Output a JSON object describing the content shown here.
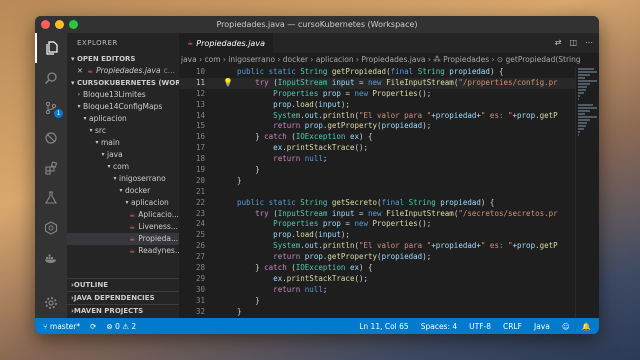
{
  "window": {
    "title": "Propiedades.java — cursoKubernetes (Workspace)"
  },
  "activity_bar": {
    "scm_badge": "1"
  },
  "sidebar": {
    "title": "EXPLORER",
    "open_editors_label": "OPEN EDITORS",
    "open_editor_file": "Propiedades.java",
    "open_editor_folder": "c...",
    "workspace_label": "CURSOKUBERNETES (WOR...",
    "tree": [
      {
        "label": "Bloque13Limites",
        "indent": 0,
        "type": "folder-collapsed"
      },
      {
        "label": "Bloque14ConfigMaps",
        "indent": 0,
        "type": "folder-open"
      },
      {
        "label": "aplicacion",
        "indent": 1,
        "type": "folder-open"
      },
      {
        "label": "src",
        "indent": 2,
        "type": "folder-open"
      },
      {
        "label": "main",
        "indent": 3,
        "type": "folder-open"
      },
      {
        "label": "java",
        "indent": 4,
        "type": "folder-open"
      },
      {
        "label": "com",
        "indent": 5,
        "type": "folder-open"
      },
      {
        "label": "inigoserrano",
        "indent": 6,
        "type": "folder-open"
      },
      {
        "label": "docker",
        "indent": 7,
        "type": "folder-open"
      },
      {
        "label": "aplicacion",
        "indent": 8,
        "type": "folder-open"
      },
      {
        "label": "Aplicacio...",
        "indent": 9,
        "type": "java"
      },
      {
        "label": "Liveness...",
        "indent": 9,
        "type": "java"
      },
      {
        "label": "Propieda...",
        "indent": 9,
        "type": "java",
        "selected": true
      },
      {
        "label": "Readynes...",
        "indent": 9,
        "type": "java"
      }
    ],
    "outline_label": "OUTLINE",
    "java_deps_label": "JAVA DEPENDENCIES",
    "maven_label": "MAVEN PROJECTS"
  },
  "editor": {
    "tab_label": "Propiedades.java",
    "breadcrumb": "java › com › inigoserrano › docker › aplicacion › Propiedades.java › ⁂ Propiedades › ⊙ getPropiedad(String",
    "lines": [
      {
        "n": "10",
        "tokens": [
          [
            "kw",
            "    public static "
          ],
          [
            "ty",
            "String "
          ],
          [
            "fn",
            "getPropiedad"
          ],
          [
            "pl",
            "("
          ],
          [
            "kw",
            "final "
          ],
          [
            "ty",
            "String "
          ],
          [
            "var",
            "propiedad"
          ],
          [
            "pl",
            ") {"
          ]
        ]
      },
      {
        "n": "11",
        "cur": true,
        "tokens": [
          [
            "ctl",
            "        try "
          ],
          [
            "pl",
            "("
          ],
          [
            "ty",
            "InputStream "
          ],
          [
            "var",
            "input"
          ],
          [
            "pl",
            " = "
          ],
          [
            "kw",
            "new "
          ],
          [
            "fn",
            "FileInputStream"
          ],
          [
            "pl",
            "("
          ],
          [
            "str",
            "\"/properties/config.pr"
          ]
        ]
      },
      {
        "n": "12",
        "tokens": [
          [
            "ty",
            "            Properties "
          ],
          [
            "var",
            "prop"
          ],
          [
            "pl",
            " = "
          ],
          [
            "kw",
            "new "
          ],
          [
            "fn",
            "Properties"
          ],
          [
            "pl",
            "();"
          ]
        ]
      },
      {
        "n": "13",
        "tokens": [
          [
            "var",
            "            prop"
          ],
          [
            "pl",
            "."
          ],
          [
            "fn",
            "load"
          ],
          [
            "pl",
            "("
          ],
          [
            "var",
            "input"
          ],
          [
            "pl",
            ");"
          ]
        ]
      },
      {
        "n": "14",
        "tokens": [
          [
            "ty",
            "            System"
          ],
          [
            "pl",
            "."
          ],
          [
            "var",
            "out"
          ],
          [
            "pl",
            "."
          ],
          [
            "fn",
            "println"
          ],
          [
            "pl",
            "("
          ],
          [
            "str",
            "\"El valor para \""
          ],
          [
            "pl",
            "+"
          ],
          [
            "var",
            "propiedad"
          ],
          [
            "pl",
            "+"
          ],
          [
            "str",
            "\" es: \""
          ],
          [
            "pl",
            "+"
          ],
          [
            "var",
            "prop"
          ],
          [
            "pl",
            "."
          ],
          [
            "fn",
            "getP"
          ]
        ]
      },
      {
        "n": "15",
        "tokens": [
          [
            "ctl",
            "            return "
          ],
          [
            "var",
            "prop"
          ],
          [
            "pl",
            "."
          ],
          [
            "fn",
            "getProperty"
          ],
          [
            "pl",
            "("
          ],
          [
            "var",
            "propiedad"
          ],
          [
            "pl",
            ");"
          ]
        ]
      },
      {
        "n": "16",
        "tokens": [
          [
            "pl",
            "        } "
          ],
          [
            "ctl",
            "catch "
          ],
          [
            "pl",
            "("
          ],
          [
            "ty",
            "IOException "
          ],
          [
            "var",
            "ex"
          ],
          [
            "pl",
            ") {"
          ]
        ]
      },
      {
        "n": "17",
        "tokens": [
          [
            "var",
            "            ex"
          ],
          [
            "pl",
            "."
          ],
          [
            "fn",
            "printStackTrace"
          ],
          [
            "pl",
            "();"
          ]
        ]
      },
      {
        "n": "18",
        "tokens": [
          [
            "ctl",
            "            return "
          ],
          [
            "kw",
            "null"
          ],
          [
            "pl",
            ";"
          ]
        ]
      },
      {
        "n": "19",
        "tokens": [
          [
            "pl",
            "        }"
          ]
        ]
      },
      {
        "n": "20",
        "tokens": [
          [
            "pl",
            "    }"
          ]
        ]
      },
      {
        "n": "21",
        "tokens": []
      },
      {
        "n": "22",
        "tokens": [
          [
            "kw",
            "    public static "
          ],
          [
            "ty",
            "String "
          ],
          [
            "fn",
            "getSecreto"
          ],
          [
            "pl",
            "("
          ],
          [
            "kw",
            "final "
          ],
          [
            "ty",
            "String "
          ],
          [
            "var",
            "propiedad"
          ],
          [
            "pl",
            ") {"
          ]
        ]
      },
      {
        "n": "23",
        "tokens": [
          [
            "ctl",
            "        try "
          ],
          [
            "pl",
            "("
          ],
          [
            "ty",
            "InputStream "
          ],
          [
            "var",
            "input"
          ],
          [
            "pl",
            " = "
          ],
          [
            "kw",
            "new "
          ],
          [
            "fn",
            "FileInputStream"
          ],
          [
            "pl",
            "("
          ],
          [
            "str",
            "\"/secretos/secretos.pr"
          ]
        ]
      },
      {
        "n": "24",
        "tokens": [
          [
            "ty",
            "            Properties "
          ],
          [
            "var",
            "prop"
          ],
          [
            "pl",
            " = "
          ],
          [
            "kw",
            "new "
          ],
          [
            "fn",
            "Properties"
          ],
          [
            "pl",
            "();"
          ]
        ]
      },
      {
        "n": "25",
        "tokens": [
          [
            "var",
            "            prop"
          ],
          [
            "pl",
            "."
          ],
          [
            "fn",
            "load"
          ],
          [
            "pl",
            "("
          ],
          [
            "var",
            "input"
          ],
          [
            "pl",
            ");"
          ]
        ]
      },
      {
        "n": "26",
        "tokens": [
          [
            "ty",
            "            System"
          ],
          [
            "pl",
            "."
          ],
          [
            "var",
            "out"
          ],
          [
            "pl",
            "."
          ],
          [
            "fn",
            "println"
          ],
          [
            "pl",
            "("
          ],
          [
            "str",
            "\"El valor para \""
          ],
          [
            "pl",
            "+"
          ],
          [
            "var",
            "propiedad"
          ],
          [
            "pl",
            "+"
          ],
          [
            "str",
            "\" es: \""
          ],
          [
            "pl",
            "+"
          ],
          [
            "var",
            "prop"
          ],
          [
            "pl",
            "."
          ],
          [
            "fn",
            "getP"
          ]
        ]
      },
      {
        "n": "27",
        "tokens": [
          [
            "ctl",
            "            return "
          ],
          [
            "var",
            "prop"
          ],
          [
            "pl",
            "."
          ],
          [
            "fn",
            "getProperty"
          ],
          [
            "pl",
            "("
          ],
          [
            "var",
            "propiedad"
          ],
          [
            "pl",
            ");"
          ]
        ]
      },
      {
        "n": "28",
        "tokens": [
          [
            "pl",
            "        } "
          ],
          [
            "ctl",
            "catch "
          ],
          [
            "pl",
            "("
          ],
          [
            "ty",
            "IOException "
          ],
          [
            "var",
            "ex"
          ],
          [
            "pl",
            ") {"
          ]
        ]
      },
      {
        "n": "29",
        "tokens": [
          [
            "var",
            "            ex"
          ],
          [
            "pl",
            "."
          ],
          [
            "fn",
            "printStackTrace"
          ],
          [
            "pl",
            "();"
          ]
        ]
      },
      {
        "n": "30",
        "tokens": [
          [
            "ctl",
            "            return "
          ],
          [
            "kw",
            "null"
          ],
          [
            "pl",
            ";"
          ]
        ]
      },
      {
        "n": "31",
        "tokens": [
          [
            "pl",
            "        }"
          ]
        ]
      },
      {
        "n": "32",
        "tokens": [
          [
            "pl",
            "    }"
          ]
        ]
      }
    ]
  },
  "statusbar": {
    "branch": "master*",
    "errors": "0",
    "warnings": "2",
    "position": "Ln 11, Col 65",
    "spaces": "Spaces: 4",
    "encoding": "UTF-8",
    "eol": "CRLF",
    "language": "Java"
  }
}
